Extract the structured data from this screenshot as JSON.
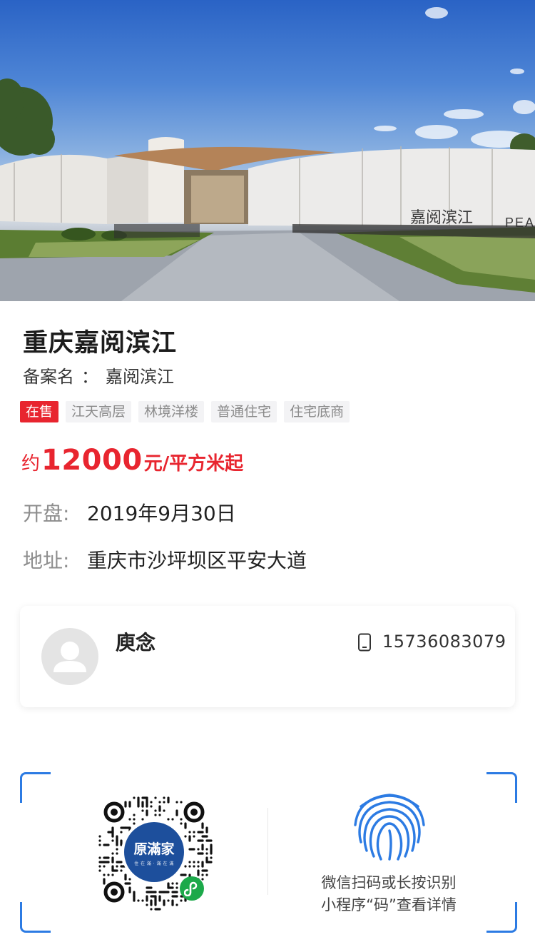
{
  "hero": {
    "signage_text": "嘉阅滨江",
    "signage_latin": "PEA"
  },
  "project": {
    "name": "重庆嘉阅滨江",
    "record_label": "备案名",
    "record_sep": "：",
    "record_name": "嘉阅滨江",
    "tags": [
      "在售",
      "江天高层",
      "林境洋楼",
      "普通住宅",
      "住宅底商"
    ],
    "price_prefix": "约",
    "price_value": "12000",
    "price_unit": "元/平方米起",
    "open_label": "开盘:",
    "open_date": "2019年9月30日",
    "address_label": "地址:",
    "address": "重庆市沙坪坝区平安大道"
  },
  "agent": {
    "name": "庾念",
    "phone": "15736083079"
  },
  "scan": {
    "qr_brand": "原滿家",
    "qr_slogan": "住 在 滿 · 滿 在 滿",
    "hint_line1": "微信扫码或长按识别",
    "hint_line2": "小程序“码”查看详情"
  },
  "colors": {
    "accent_red": "#e8252f",
    "scan_blue": "#2c7be3",
    "wechat_green": "#1ca94a",
    "brand_navy": "#1d4f9c"
  },
  "icons": [
    "avatar-placeholder-icon",
    "phone-icon",
    "mini-program-icon",
    "fingerprint-icon"
  ]
}
